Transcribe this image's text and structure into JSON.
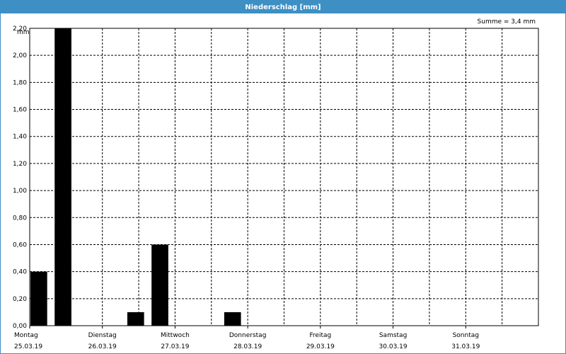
{
  "window": {
    "title": "Niederschlag [mm]",
    "title_bar_color": "#3d8fc4"
  },
  "summary": "Summe = 3,4 mm",
  "chart_data": {
    "type": "bar",
    "ylabel": "mm",
    "ylim": [
      0,
      2.2
    ],
    "y_ticks": [
      "0,00",
      "0,20",
      "0,40",
      "0,60",
      "0,80",
      "1,00",
      "1,20",
      "1,40",
      "1,60",
      "1,80",
      "2,00",
      "2,20"
    ],
    "grid": true,
    "bar_color": "#000000",
    "x_unit": "hours since 25.03.19 00:00",
    "days": [
      {
        "name": "Montag",
        "date": "25.03.19"
      },
      {
        "name": "Dienstag",
        "date": "26.03.19"
      },
      {
        "name": "Mittwoch",
        "date": "27.03.19"
      },
      {
        "name": "Donnerstag",
        "date": "28.03.19"
      },
      {
        "name": "Freitag",
        "date": "29.03.19"
      },
      {
        "name": "Samstag",
        "date": "30.03.19"
      },
      {
        "name": "Sonntag",
        "date": "31.03.19"
      }
    ],
    "bars": [
      {
        "start": 0,
        "end": 6,
        "value": 0.4
      },
      {
        "start": 8,
        "end": 14,
        "value": 2.2
      },
      {
        "start": 32,
        "end": 38,
        "value": 0.1
      },
      {
        "start": 40,
        "end": 46,
        "value": 0.6
      },
      {
        "start": 64,
        "end": 70,
        "value": 0.1
      }
    ]
  }
}
